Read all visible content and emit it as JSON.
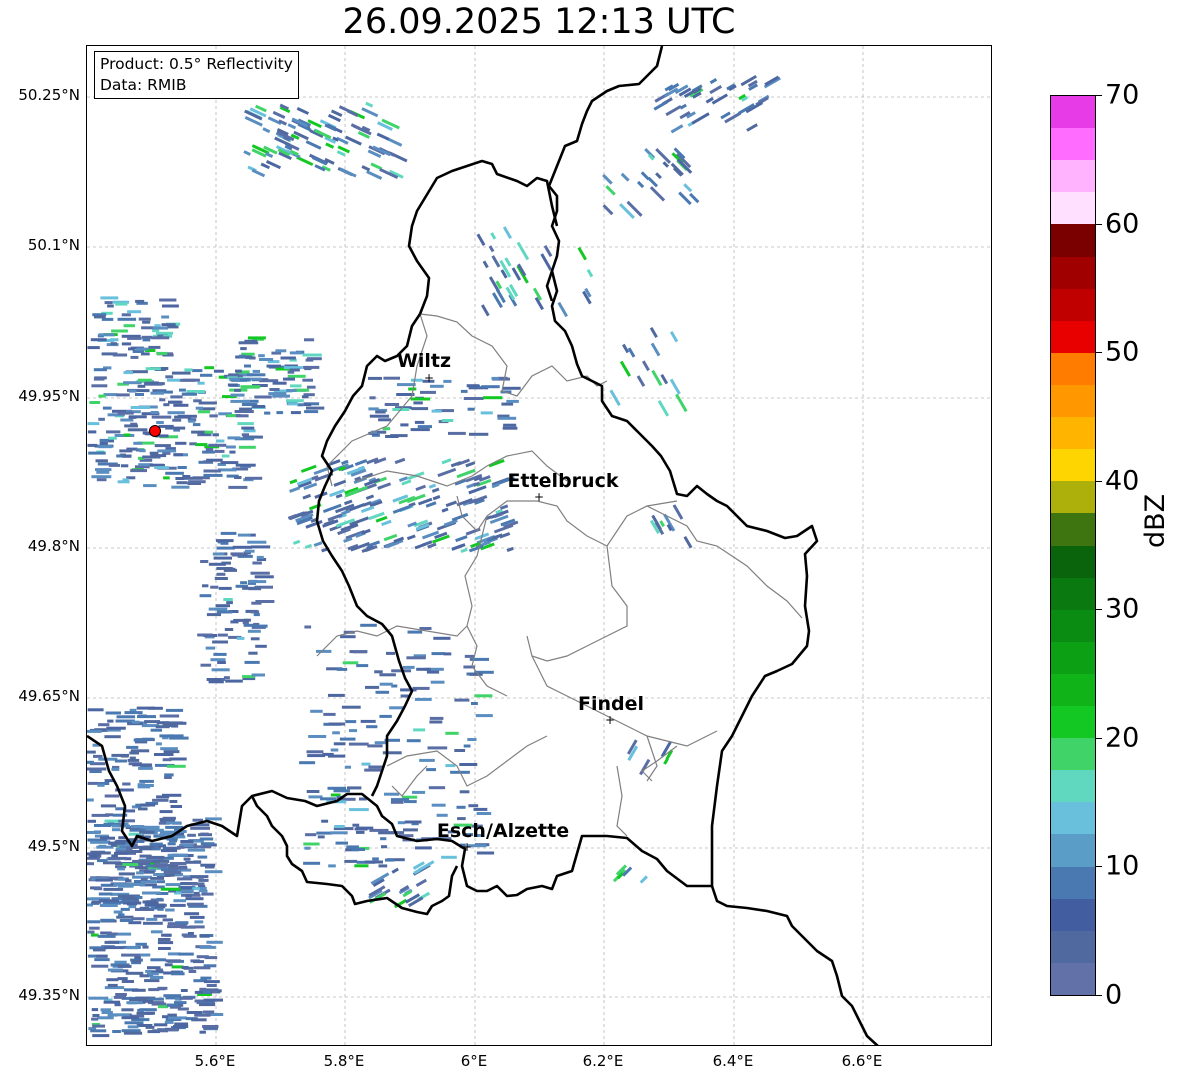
{
  "title": "26.09.2025 12:13 UTC",
  "info_box": {
    "product": "Product: 0.5° Reflectivity",
    "data_source": "Data: RMIB"
  },
  "lat_ticks": [
    "50.25°N",
    "50.1°N",
    "49.95°N",
    "49.8°N",
    "49.65°N",
    "49.5°N",
    "49.35°N"
  ],
  "lon_ticks": [
    "5.6°E",
    "5.8°E",
    "6°E",
    "6.2°E",
    "6.4°E",
    "6.6°E"
  ],
  "cities": [
    {
      "name": "Wiltz"
    },
    {
      "name": "Ettelbruck"
    },
    {
      "name": "Findel"
    },
    {
      "name": "Esch/Alzette"
    }
  ],
  "city_marker": "+",
  "colorbar": {
    "label": "dBZ",
    "ticks": [
      "0",
      "10",
      "20",
      "30",
      "40",
      "50",
      "60",
      "70"
    ],
    "colors": [
      "#6272a8",
      "#506aa0",
      "#425ea0",
      "#4a78b0",
      "#5a9ec8",
      "#68c0dc",
      "#60d8c0",
      "#40d468",
      "#14c824",
      "#10b418",
      "#0ca014",
      "#0a8c12",
      "#0a7a10",
      "#0a640c",
      "#3f7510",
      "#adb00a",
      "#fed500",
      "#ffb400",
      "#ff9800",
      "#ff7c00",
      "#e80000",
      "#c00000",
      "#a00000",
      "#7a0000",
      "#ffe0ff",
      "#ffb3ff",
      "#ff6cff",
      "#e83be8"
    ]
  },
  "radar_site_color": "#ff0000"
}
